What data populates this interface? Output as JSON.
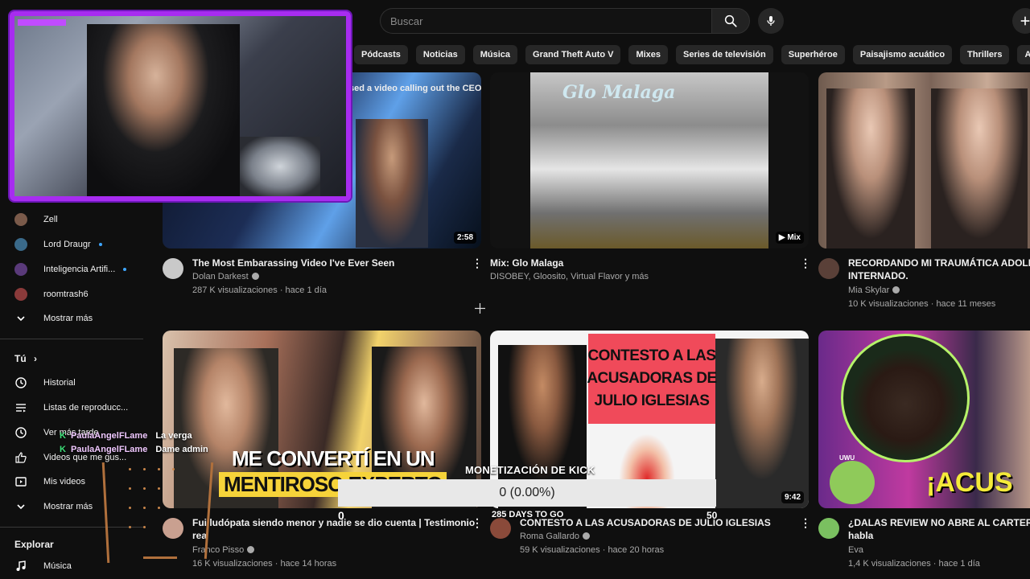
{
  "header": {
    "search_placeholder": "Buscar",
    "search_icon": "search-icon",
    "mic_icon": "mic-icon",
    "create_icon": "plus-icon"
  },
  "chips": [
    "Pódcasts",
    "Noticias",
    "Música",
    "Grand Theft Auto V",
    "Mixes",
    "Series de televisión",
    "Superhéroe",
    "Paisajismo acuático",
    "Thrillers",
    "Animación"
  ],
  "sidebar": {
    "subscriptions": [
      {
        "label": "Zell",
        "live": false,
        "color": "#7a5a4a"
      },
      {
        "label": "Lord Draugr",
        "live": true,
        "color": "#3a6a8a"
      },
      {
        "label": "Inteligencia Artifi...",
        "live": true,
        "color": "#5a3a7a"
      },
      {
        "label": "roomtrash6",
        "live": false,
        "color": "#8a3a3a"
      }
    ],
    "show_more_1": "Mostrar más",
    "you_heading": "Tú",
    "you_items": [
      {
        "label": "Historial",
        "icon": "history-icon"
      },
      {
        "label": "Listas de reproducc...",
        "icon": "playlists-icon"
      },
      {
        "label": "Ver más tarde",
        "icon": "watch-later-icon"
      },
      {
        "label": "Videos que me gus...",
        "icon": "like-icon"
      },
      {
        "label": "Mis videos",
        "icon": "my-videos-icon"
      }
    ],
    "show_more_2": "Mostrar más",
    "explore_heading": "Explorar",
    "explore_items": [
      {
        "label": "Música",
        "icon": "music-icon"
      }
    ]
  },
  "videos": [
    {
      "title": "The Most Embarassing Video I've Ever Seen",
      "channel": "Dolan Darkest",
      "verified": true,
      "stats": "287 K visualizaciones · hace 1 día",
      "duration": "2:58",
      "thumb_text": "sed a video calling out the CEO of"
    },
    {
      "title": "Mix: Glo Malaga",
      "channel": "DISOBEY, Gloosito, Virtual Flavor y más",
      "verified": false,
      "stats": "",
      "duration": "Mix",
      "thumb_text": "Glo Malaga"
    },
    {
      "title": "RECORDANDO MI TRAUMÁTICA ADOLESC",
      "title_line2": "INTERNADO.",
      "channel": "Mia Skylar",
      "verified": true,
      "stats": "10 K visualizaciones · hace 11 meses",
      "duration": ""
    },
    {
      "title": "Fui ludópata siendo menor y nadie se dio cuenta  | Testimonio",
      "title_line2": "rea",
      "channel": "Franco Pisso",
      "verified": true,
      "stats": "16 K visualizaciones · hace 14 horas",
      "duration": "",
      "thumb_text_1": "ME CONVERTÍ EN UN",
      "thumb_text_2": "MENTIROSO EXPERTO"
    },
    {
      "title": "CONTESTO A LAS ACUSADORAS DE JULIO IGLESIAS",
      "channel": "Roma Gallardo",
      "verified": true,
      "stats": "59 K visualizaciones · hace 20 horas",
      "duration": "9:42",
      "thumb_text_1": "CONTESTO A LAS",
      "thumb_text_2": "ACUSADORAS DE",
      "thumb_text_3": "JULIO IGLESIAS"
    },
    {
      "title": "¿DALAS REVIEW NO ABRE AL CARTERO?",
      "title_line2": "habla",
      "channel": "Eva",
      "verified": false,
      "stats": "1,4 K visualizaciones · hace 1 día",
      "duration": "",
      "thumb_text_1": "¡ACUS",
      "thumb_text_2": "UWU"
    }
  ],
  "monetization": {
    "label": "MONETIZACIÓN DE KICK",
    "value": "0 (0.00%)",
    "start": "0",
    "days": "285 DAYS TO GO",
    "goal": "50",
    "progress": 0
  },
  "chat": [
    {
      "user": "PaulaAngelFLame",
      "message": "La verga"
    },
    {
      "user": "PaulaAngelFLame",
      "message": "Dame admin"
    }
  ],
  "colors": {
    "background": "#0f0f0f",
    "webcam_border": "#a72cf0",
    "chip_bg": "#272727",
    "live_dot": "#3ea6ff"
  }
}
